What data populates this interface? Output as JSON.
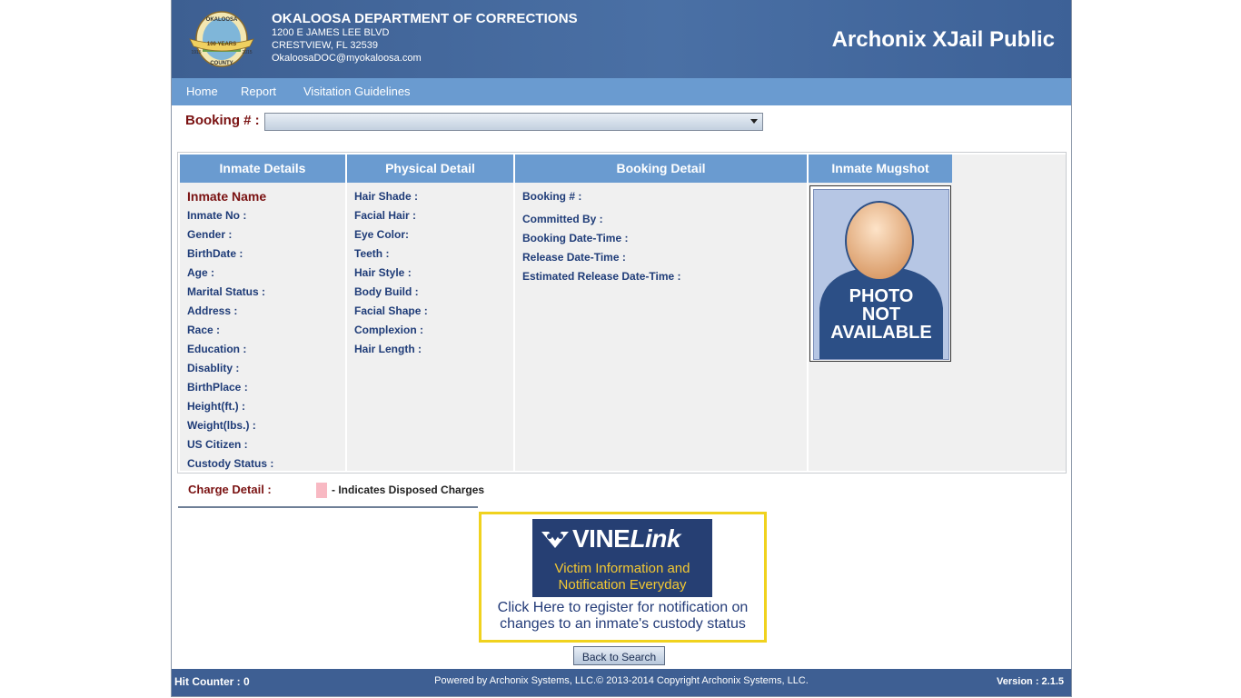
{
  "header": {
    "org_name": "OKALOOSA DEPARTMENT OF CORRECTIONS",
    "address1": "1200 E JAMES LEE BLVD",
    "address2": "CRESTVIEW, FL 32539",
    "email": "OkaloosaDOC@myokaloosa.com",
    "app_name": "Archonix XJail Public",
    "seal": {
      "top": "OKALOOSA",
      "middle": "100 YEARS",
      "bottom": "COUNTY",
      "year_left": "1915",
      "year_right": "2015"
    }
  },
  "nav": {
    "home": "Home",
    "report": "Report",
    "visitation": "Visitation Guidelines"
  },
  "booking": {
    "label": "Booking # :",
    "selected": ""
  },
  "inmate_details": {
    "heading": "Inmate Details",
    "name_label": "Inmate Name",
    "fields": [
      "Inmate No :",
      "Gender :",
      "BirthDate :",
      "Age :",
      "Marital Status :",
      "Address :",
      "Race :",
      "Education :",
      "Disablity :",
      "BirthPlace :",
      "Height(ft.) :",
      "Weight(lbs.) :",
      "US Citizen :",
      "Custody Status :"
    ]
  },
  "physical_detail": {
    "heading": "Physical Detail",
    "fields": [
      "Hair Shade :",
      "Facial Hair :",
      "Eye Color:",
      "Teeth :",
      "Hair Style :",
      "Body Build :",
      "Facial Shape :",
      "Complexion :",
      "Hair Length :"
    ]
  },
  "booking_detail": {
    "heading": "Booking Detail",
    "booking_no": "Booking # :",
    "fields": [
      "Committed By :",
      "Booking Date-Time :",
      "Release Date-Time :",
      "Estimated Release Date-Time :"
    ]
  },
  "mugshot": {
    "heading": "Inmate Mugshot",
    "placeholder_line1": "PHOTO",
    "placeholder_line2": "NOT",
    "placeholder_line3": "AVAILABLE"
  },
  "charge": {
    "label": "Charge Detail :",
    "legend": "- Indicates Disposed Charges",
    "legend_color": "#f8b9c3"
  },
  "vine": {
    "logo_vine": "VINE",
    "logo_link": "Link",
    "tagline1": "Victim Information and",
    "tagline2": "Notification Everyday",
    "cta1": "Click Here to register for notification on",
    "cta2": "changes to an inmate's custody status"
  },
  "back_button": "Back to Search",
  "footer": {
    "hit_counter": "Hit Counter : 0",
    "powered": "Powered by Archonix Systems, LLC.© 2013-2014 Copyright Archonix Systems, LLC.",
    "version": "Version : 2.1.5"
  },
  "colors": {
    "header": "#4a70a5",
    "nav": "#6a9bd0",
    "label_dark_red": "#7a1212",
    "field_blue": "#1f3c78",
    "vine_border": "#f0d21e"
  }
}
